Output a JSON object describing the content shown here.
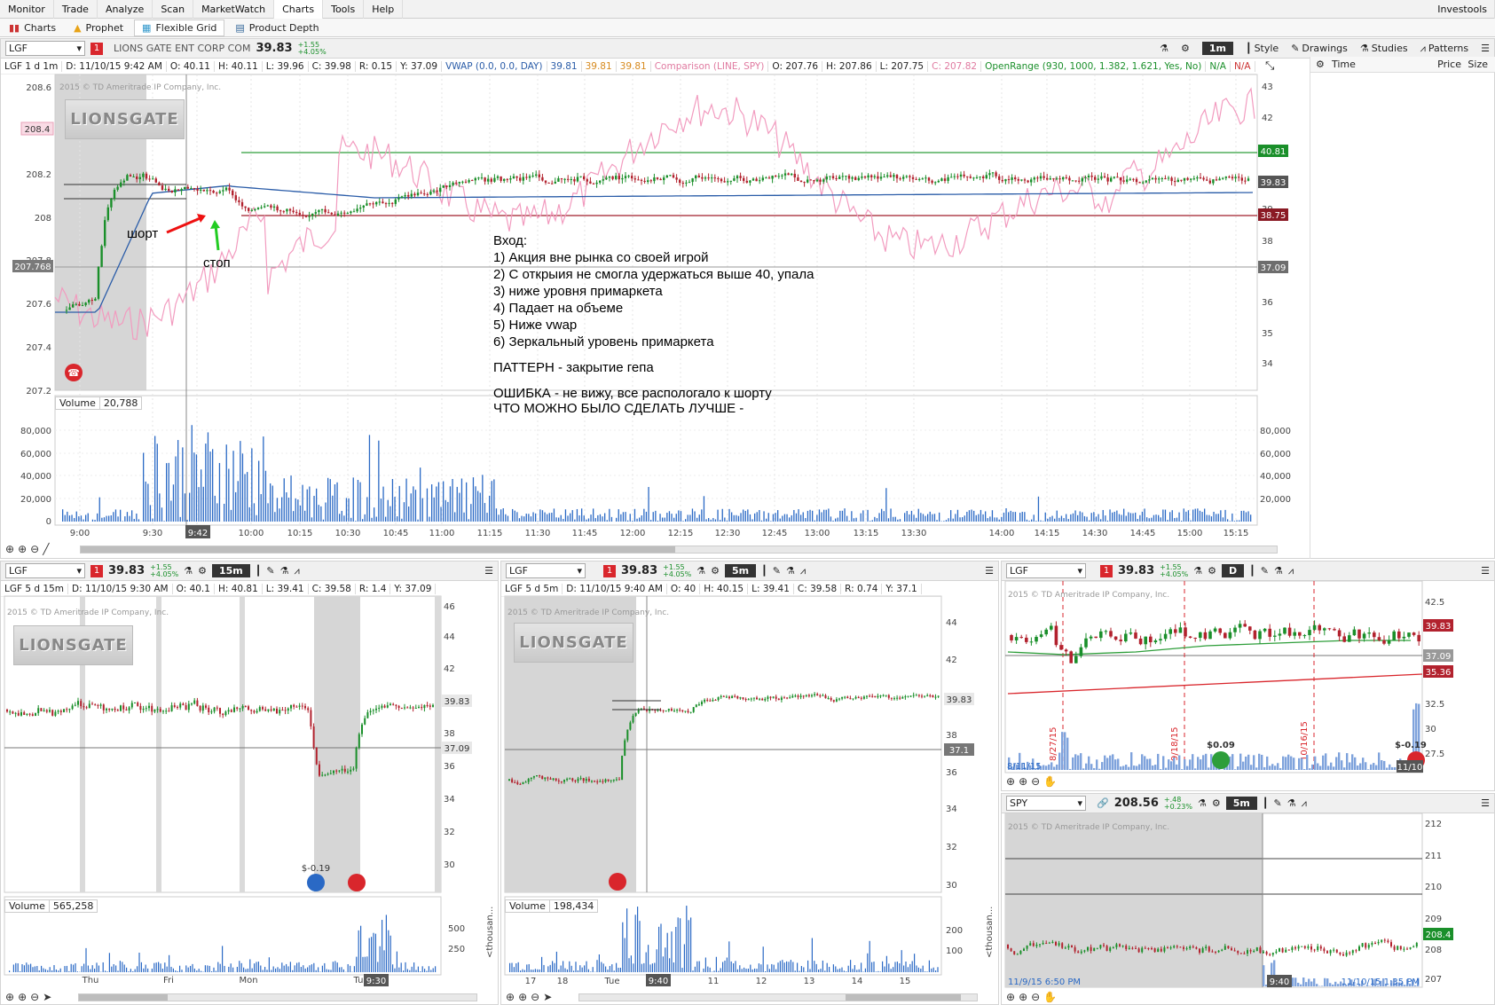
{
  "menu": {
    "items": [
      "Monitor",
      "Trade",
      "Analyze",
      "Scan",
      "MarketWatch",
      "Charts",
      "Tools",
      "Help"
    ],
    "active": "Charts",
    "right": "Investools"
  },
  "subtabs": {
    "items": [
      "Charts",
      "Prophet",
      "Flexible Grid",
      "Product Depth"
    ],
    "active": "Flexible Grid"
  },
  "main": {
    "symbol": "LGF",
    "alert": "1",
    "company": "LIONS GATE ENT CORP COM",
    "price": "39.83",
    "chg1": "+1.55",
    "chg2": "+4.05%",
    "aggregation": "1m",
    "toolbar": {
      "style": "Style",
      "drawings": "Drawings",
      "studies": "Studies",
      "patterns": "Patterns"
    },
    "info": [
      "LGF 1 d 1m",
      "D: 11/10/15 9:42 AM",
      "O: 40.11",
      "H: 40.11",
      "L: 39.96",
      "C: 39.98",
      "R: 0.15",
      "Y: 37.09",
      "VWAP (0.0, 0.0, DAY)",
      "39.81",
      "39.81",
      "39.81",
      "Comparison (LINE, SPY)",
      "O: 207.76",
      "H: 207.86",
      "L: 207.75",
      "C: 207.82",
      "OpenRange (930, 1000, 1.382, 1.621, Yes, No)",
      "N/A",
      "N/A"
    ],
    "watermark": "2015 © TD Ameritrade IP Company, Inc.",
    "logo": "LIONSGATE",
    "left_axis": [
      "208.6",
      "208.4",
      "208.2",
      "208",
      "207.8",
      "207.768",
      "207.6",
      "207.4",
      "207.2"
    ],
    "right_axis": [
      "43",
      "42",
      "40.81",
      "39.83",
      "39",
      "38.75",
      "38",
      "37.09",
      "36",
      "35",
      "34"
    ],
    "time_axis": [
      "9:00",
      "9:30",
      "9:42",
      "10:00",
      "10:15",
      "10:30",
      "10:45",
      "11:00",
      "11:15",
      "11:30",
      "11:45",
      "12:00",
      "12:15",
      "12:30",
      "12:45",
      "13:00",
      "13:15",
      "13:30",
      "14:00",
      "14:15",
      "14:30",
      "14:45",
      "15:00",
      "15:15"
    ],
    "volume_label": "Volume",
    "volume_value": "20,788",
    "volume_axis": [
      "80,000",
      "60,000",
      "40,000",
      "20,000",
      "0"
    ],
    "annotations": {
      "short": "шорт",
      "stop": "стоп"
    },
    "notes": [
      "Вход:",
      "1) Акция вне рынка со своей игрой",
      "2) С открыия не смогла удержаться выше 40, упала",
      "3) ниже уровня примаркета",
      "4) Падает на объеме",
      "5) Ниже vwap",
      "6) Зеркальный уровень примаркета",
      "",
      "ПАТТЕРН - закрытие гепа",
      "",
      "ОШИБКА - не вижу, все распологало к шорту",
      "ЧТО МОЖНО БЫЛО СДЕЛАТЬ ЛУЧШЕ -"
    ]
  },
  "timesales": {
    "headers": [
      "Time",
      "Price",
      "Size"
    ]
  },
  "chart2": {
    "symbol": "LGF",
    "alert": "1",
    "price": "39.83",
    "chg1": "+1.55",
    "chg2": "+4.05%",
    "aggregation": "15m",
    "info": [
      "LGF 5 d 15m",
      "D: 11/10/15 9:30 AM",
      "O: 40.1",
      "H: 40.81",
      "L: 39.41",
      "C: 39.58",
      "R: 1.4",
      "Y: 37.09"
    ],
    "right_axis": [
      "46",
      "44",
      "42",
      "39.83",
      "38",
      "37.09",
      "36",
      "34",
      "32",
      "30"
    ],
    "dividend": "$-0.19",
    "volume_label": "Volume",
    "volume_value": "565,258",
    "volume_axis": [
      "500",
      "250"
    ],
    "time_axis": [
      "Thu",
      "Fri",
      "Mon",
      "Tu",
      "9:30"
    ]
  },
  "chart3": {
    "symbol": "LGF",
    "alert": "1",
    "price": "39.83",
    "chg1": "+1.55",
    "chg2": "+4.05%",
    "aggregation": "5m",
    "info": [
      "LGF 5 d 5m",
      "D: 11/10/15 9:40 AM",
      "O: 40",
      "H: 40.15",
      "L: 39.41",
      "C: 39.58",
      "R: 0.74",
      "Y: 37.1"
    ],
    "right_axis": [
      "44",
      "42",
      "39.83",
      "38",
      "37.1",
      "36",
      "34",
      "32",
      "30"
    ],
    "volume_label": "Volume",
    "volume_value": "198,434",
    "volume_axis": [
      "200",
      "100"
    ],
    "vol_unit": "<thousan...",
    "time_axis": [
      "17",
      "18",
      "Tue",
      "9:40",
      "11",
      "12",
      "13",
      "14",
      "15"
    ]
  },
  "chart4": {
    "symbol": "LGF",
    "alert": "1",
    "price": "39.83",
    "chg1": "+1.55",
    "chg2": "+4.05%",
    "aggregation": "D",
    "right_axis": [
      "42.5",
      "39.83",
      "37.09",
      "35.36",
      "32.5",
      "30",
      "27.5"
    ],
    "dates": [
      "8/27/15",
      "9/18/15",
      "10/16/15"
    ],
    "dividends": [
      "$0.09",
      "$-0.19"
    ],
    "start": "8/11/15",
    "end": "11/10"
  },
  "chart5": {
    "symbol": "SPY",
    "price": "208.56",
    "chg1": "+.48",
    "chg2": "+0.23%",
    "aggregation": "5m",
    "right_axis": [
      "212",
      "211",
      "210",
      "209",
      "208.4",
      "208",
      "207"
    ],
    "start": "11/9/15 6:50 PM",
    "cursor": "9:40",
    "end": "11/10/15 1:35 PM"
  },
  "colors": {
    "accent": "#1a8f2a",
    "alert": "#d9262c",
    "vwap": "#2a5ca8",
    "comparison": "#f29bbf",
    "green_line": "#2e9e3a",
    "red_line": "#a11d2b"
  }
}
